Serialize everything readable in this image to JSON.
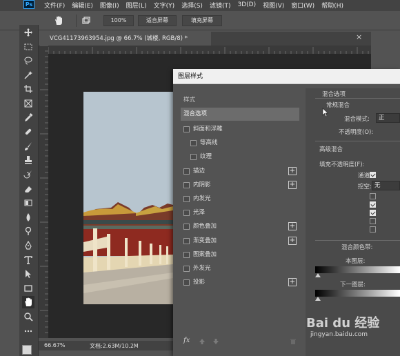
{
  "app": {
    "logo": "Ps"
  },
  "menu": [
    "文件(F)",
    "编辑(E)",
    "图像(I)",
    "图层(L)",
    "文字(Y)",
    "选择(S)",
    "滤镜(T)",
    "3D(D)",
    "视图(V)",
    "窗口(W)",
    "帮助(H)"
  ],
  "options_bar": {
    "zoom_value": "100%",
    "fit_screen": "适合屏幕",
    "fill_screen": "填充屏幕"
  },
  "toolbar": {
    "icons": [
      "move-icon",
      "marquee-icon",
      "lasso-icon",
      "magic-wand-icon",
      "crop-icon",
      "frame-icon",
      "eyedropper-icon",
      "healing-brush-icon",
      "brush-icon",
      "clone-stamp-icon",
      "history-brush-icon",
      "eraser-icon",
      "gradient-icon",
      "blur-icon",
      "dodge-icon",
      "pen-icon",
      "type-icon",
      "path-selection-icon",
      "rectangle-icon",
      "hand-icon",
      "zoom-icon",
      "more-icon"
    ]
  },
  "document": {
    "tab_title": "VCG41173963954.jpg @ 66.7% (城楼, RGB/8) *",
    "close_symbol": "×"
  },
  "status": {
    "zoom": "66.67%",
    "doc_size": "文档:2.63M/10.2M",
    "arrow": ">"
  },
  "dialog": {
    "title": "图层样式",
    "list": {
      "header": "样式",
      "selected": "混合选项",
      "items": [
        {
          "label": "斜面和浮雕",
          "plus": false,
          "indent": false
        },
        {
          "label": "等高线",
          "plus": false,
          "indent": true
        },
        {
          "label": "纹理",
          "plus": false,
          "indent": true
        },
        {
          "label": "描边",
          "plus": true,
          "indent": false
        },
        {
          "label": "内阴影",
          "plus": true,
          "indent": false
        },
        {
          "label": "内发光",
          "plus": false,
          "indent": false
        },
        {
          "label": "光泽",
          "plus": false,
          "indent": false
        },
        {
          "label": "颜色叠加",
          "plus": true,
          "indent": false
        },
        {
          "label": "渐变叠加",
          "plus": true,
          "indent": false
        },
        {
          "label": "图案叠加",
          "plus": false,
          "indent": false
        },
        {
          "label": "外发光",
          "plus": false,
          "indent": false
        },
        {
          "label": "投影",
          "plus": true,
          "indent": false
        }
      ],
      "plus_symbol": "+",
      "fx_label": "fx"
    },
    "right": {
      "section_title": "混合选项",
      "normal_blend": "常规混合",
      "blend_mode_label": "混合模式:",
      "blend_mode_value": "正",
      "opacity_label": "不透明度(O):",
      "advanced_blend": "高级混合",
      "fill_opacity_label": "填充不透明度(F):",
      "channels_label": "通道:",
      "knockout_label": "挖空:",
      "knockout_value": "无",
      "blend_if_label": "混合颜色带:",
      "this_layer_label": "本图层:",
      "underlying_label": "下一图层:"
    }
  },
  "watermark": {
    "brand": "Bai du 经验",
    "url": "jingyan.baidu.com"
  }
}
